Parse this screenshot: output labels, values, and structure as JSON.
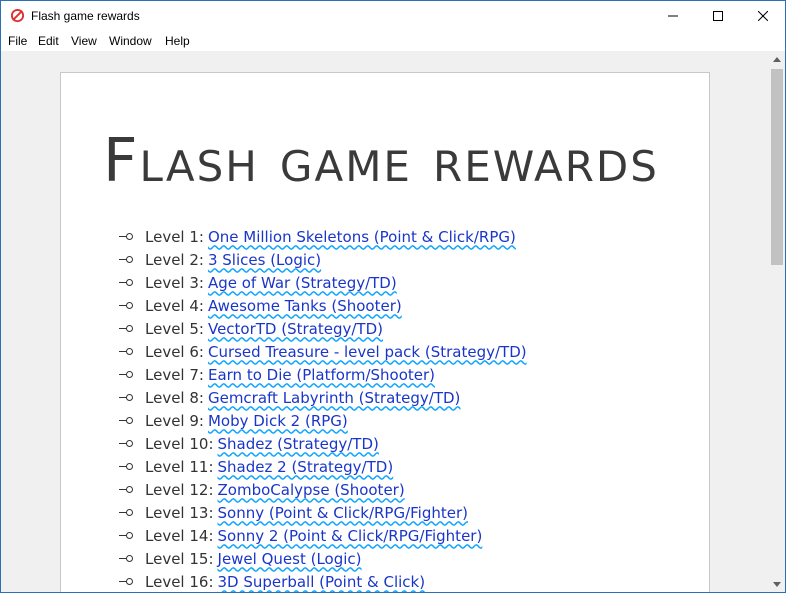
{
  "window": {
    "title": "Flash game rewards",
    "controls": [
      "minimize-icon",
      "maximize-icon",
      "close-icon"
    ]
  },
  "menu": [
    "File",
    "Edit",
    "View",
    "Window",
    "Help"
  ],
  "page": {
    "heading": "Flash game rewards",
    "items": [
      {
        "level": "Level 1:",
        "game": "One Million Skeletons (Point & Click/RPG)"
      },
      {
        "level": "Level 2:",
        "game": "3 Slices (Logic)"
      },
      {
        "level": "Level 3:",
        "game": "Age of War (Strategy/TD)"
      },
      {
        "level": "Level 4:",
        "game": "Awesome Tanks (Shooter)"
      },
      {
        "level": "Level 5:",
        "game": "VectorTD (Strategy/TD)"
      },
      {
        "level": "Level 6:",
        "game": "Cursed Treasure - level pack (Strategy/TD)"
      },
      {
        "level": "Level 7:",
        "game": "Earn to Die (Platform/Shooter)"
      },
      {
        "level": "Level 8:",
        "game": "Gemcraft Labyrinth (Strategy/TD)"
      },
      {
        "level": "Level 9:",
        "game": "Moby Dick 2 (RPG)"
      },
      {
        "level": "Level 10:",
        "game": "Shadez (Strategy/TD)"
      },
      {
        "level": "Level 11:",
        "game": "Shadez 2 (Strategy/TD)"
      },
      {
        "level": "Level 12:",
        "game": "ZomboCalypse (Shooter)"
      },
      {
        "level": "Level 13:",
        "game": "Sonny (Point & Click/RPG/Fighter)"
      },
      {
        "level": "Level 14:",
        "game": "Sonny 2 (Point & Click/RPG/Fighter)"
      },
      {
        "level": "Level 15:",
        "game": "Jewel Quest (Logic)"
      },
      {
        "level": "Level 16:",
        "game": "3D Superball (Point & Click)"
      }
    ]
  }
}
